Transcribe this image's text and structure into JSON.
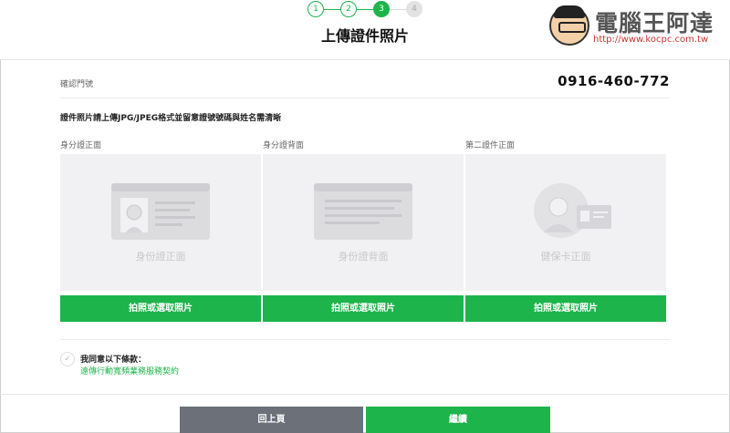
{
  "steps": [
    {
      "label": "1",
      "state": "done"
    },
    {
      "label": "2",
      "state": "done"
    },
    {
      "label": "3",
      "state": "active"
    },
    {
      "label": "4",
      "state": "todo"
    }
  ],
  "header": {
    "title": "上傳證件照片"
  },
  "watermark": {
    "brand": "電腦王阿達",
    "url": "http://www.kocpc.com.tw"
  },
  "phone": {
    "label": "確認門號",
    "value": "0916-460-772"
  },
  "instruction": "證件照片請上傳JPG/JPEG格式並留意證號號碼與姓名需清晰",
  "cards": [
    {
      "label": "身分證正面",
      "caption": "身份證正面",
      "button": "拍照或選取照片",
      "icon": "id-card-front-icon"
    },
    {
      "label": "身分證背面",
      "caption": "身份證背面",
      "button": "拍照或選取照片",
      "icon": "id-card-back-icon"
    },
    {
      "label": "第二證件正面",
      "caption": "健保卡正面",
      "button": "拍照或選取照片",
      "icon": "health-card-icon"
    }
  ],
  "agreement": {
    "title": "我同意以下條款：",
    "link": "遠傳行動寬頻業務服務契約"
  },
  "footer": {
    "back": "回上頁",
    "next": "繼續"
  },
  "colors": {
    "accent": "#1db44b",
    "back_button": "#6b7079",
    "placeholder_bg": "#f1f1f3"
  }
}
